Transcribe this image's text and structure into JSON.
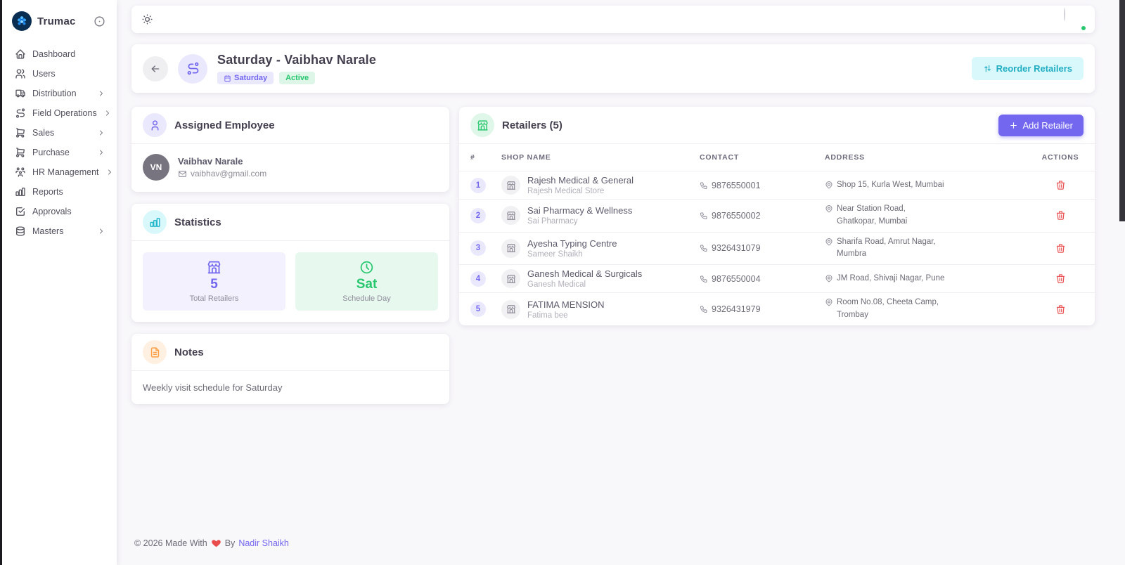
{
  "brand": {
    "name": "Trumac"
  },
  "sidebar": {
    "items": [
      {
        "label": "Dashboard",
        "icon": "home-icon",
        "expandable": false
      },
      {
        "label": "Users",
        "icon": "users-icon",
        "expandable": false
      },
      {
        "label": "Distribution",
        "icon": "truck-icon",
        "expandable": true
      },
      {
        "label": "Field Operations",
        "icon": "route-icon",
        "expandable": true
      },
      {
        "label": "Sales",
        "icon": "cart-icon",
        "expandable": true
      },
      {
        "label": "Purchase",
        "icon": "cart-icon",
        "expandable": true
      },
      {
        "label": "HR Management",
        "icon": "people-icon",
        "expandable": true
      },
      {
        "label": "Reports",
        "icon": "chart-icon",
        "expandable": false
      },
      {
        "label": "Approvals",
        "icon": "checkbox-icon",
        "expandable": false
      },
      {
        "label": "Masters",
        "icon": "database-icon",
        "expandable": true
      }
    ]
  },
  "header": {
    "title": "Saturday - Vaibhav Narale",
    "day_badge": "Saturday",
    "status_badge": "Active",
    "reorder_button": "Reorder Retailers"
  },
  "assigned_employee": {
    "section_title": "Assigned Employee",
    "avatar_initials": "VN",
    "name": "Vaibhav Narale",
    "email": "vaibhav@gmail.com"
  },
  "statistics": {
    "section_title": "Statistics",
    "tiles": [
      {
        "value": "5",
        "label": "Total Retailers"
      },
      {
        "value": "Sat",
        "label": "Schedule Day"
      }
    ]
  },
  "notes": {
    "section_title": "Notes",
    "content": "Weekly visit schedule for Saturday"
  },
  "retailers": {
    "section_title": "Retailers (5)",
    "add_button": "Add Retailer",
    "columns": [
      "#",
      "SHOP NAME",
      "CONTACT",
      "ADDRESS",
      "ACTIONS"
    ],
    "rows": [
      {
        "num": "1",
        "shop_name": "Rajesh Medical & General",
        "owner": "Rajesh Medical Store",
        "contact": "9876550001",
        "address": "Shop 15, Kurla West, Mumbai"
      },
      {
        "num": "2",
        "shop_name": "Sai Pharmacy & Wellness",
        "owner": "Sai Pharmacy",
        "contact": "9876550002",
        "address": "Near Station Road, Ghatkopar, Mumbai"
      },
      {
        "num": "3",
        "shop_name": "Ayesha Typing Centre",
        "owner": "Sameer Shaikh",
        "contact": "9326431079",
        "address": "Sharifa Road, Amrut Nagar, Mumbra"
      },
      {
        "num": "4",
        "shop_name": "Ganesh Medical & Surgicals",
        "owner": "Ganesh Medical",
        "contact": "9876550004",
        "address": "JM Road, Shivaji Nagar, Pune"
      },
      {
        "num": "5",
        "shop_name": "FATIMA MENSION",
        "owner": "Fatima bee",
        "contact": "9326431979",
        "address": "Room No.08, Cheeta Camp, Trombay"
      }
    ]
  },
  "footer": {
    "copyright": "© 2026 Made With",
    "by": "By",
    "author": "Nadir Shaikh"
  },
  "colors": {
    "primary": "#7367f0",
    "success": "#28c76f",
    "info": "#00bad1",
    "danger": "#ea5455",
    "warning": "#ff9f43",
    "background": "#f8f7fa"
  }
}
